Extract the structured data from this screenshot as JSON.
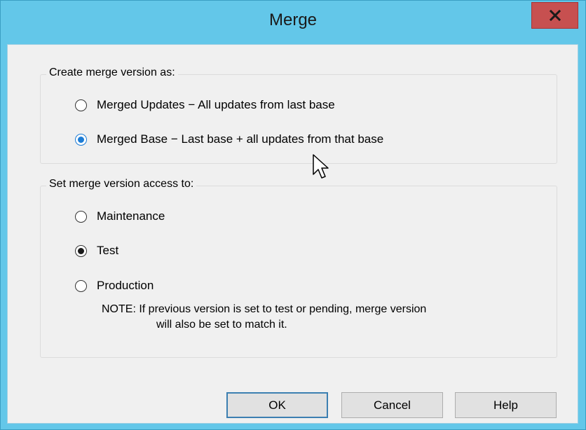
{
  "window": {
    "title": "Merge",
    "close_label": "x"
  },
  "create_group": {
    "label": "Create merge version as:",
    "options": [
      {
        "label": "Merged Updates − All updates from last base",
        "checked": false
      },
      {
        "label": "Merged Base − Last base + all updates from that base",
        "checked": true
      }
    ]
  },
  "access_group": {
    "label": "Set merge version access to:",
    "options": [
      {
        "label": "Maintenance",
        "checked": false
      },
      {
        "label": "Test",
        "checked": true
      },
      {
        "label": "Production",
        "checked": false
      }
    ],
    "note_line1": "NOTE:  If previous version is set to test or pending, merge version",
    "note_line2": "will also be set to match it."
  },
  "buttons": {
    "ok": "OK",
    "cancel": "Cancel",
    "help": "Help"
  },
  "colors": {
    "titlebar": "#63c7e9",
    "close": "#c75050",
    "accent": "#1c7cd5"
  }
}
